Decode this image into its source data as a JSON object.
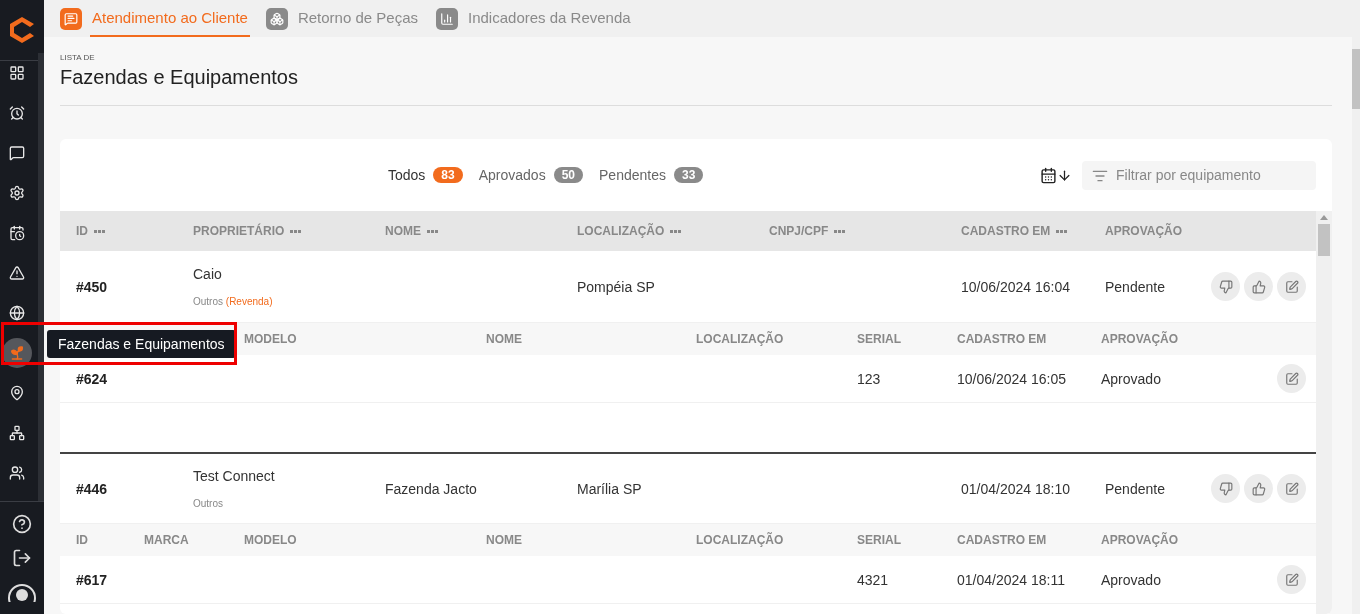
{
  "sidebar": {
    "items": [
      {
        "kind": "grid",
        "selected": false
      },
      {
        "kind": "alarm",
        "selected": false
      },
      {
        "kind": "chat",
        "selected": false
      },
      {
        "kind": "gear",
        "selected": false
      },
      {
        "kind": "calendar",
        "selected": false
      },
      {
        "kind": "warning",
        "selected": false
      },
      {
        "kind": "globe",
        "selected": false
      },
      {
        "kind": "plant",
        "selected": true
      },
      {
        "kind": "pin",
        "selected": false
      },
      {
        "kind": "network",
        "selected": false
      },
      {
        "kind": "users",
        "selected": false
      }
    ],
    "bottom": [
      {
        "kind": "help"
      },
      {
        "kind": "logout"
      },
      {
        "kind": "profile"
      }
    ],
    "tooltip": "Fazendas e Equipamentos"
  },
  "tabs": [
    {
      "label": "Atendimento ao Cliente",
      "kind": "support",
      "selected": true
    },
    {
      "label": "Retorno de Peças",
      "kind": "parts",
      "selected": false
    },
    {
      "label": "Indicadores da Revenda",
      "kind": "chart",
      "selected": false
    }
  ],
  "header": {
    "overline": "LISTA DE",
    "title": "Fazendas e Equipamentos"
  },
  "filters": [
    {
      "label": "Todos",
      "count": "83",
      "selected": true
    },
    {
      "label": "Aprovados",
      "count": "50",
      "selected": false
    },
    {
      "label": "Pendentes",
      "count": "33",
      "selected": false
    }
  ],
  "search": {
    "placeholder": "Filtrar por equipamento"
  },
  "table": {
    "columns": [
      {
        "label": "ID",
        "menu": true
      },
      {
        "label": "PROPRIETÁRIO",
        "menu": true
      },
      {
        "label": "NOME",
        "menu": true
      },
      {
        "label": "LOCALIZAÇÃO",
        "menu": true
      },
      {
        "label": "CNPJ/CPF",
        "menu": true
      },
      {
        "label": "CADASTRO EM",
        "menu": true
      },
      {
        "label": "APROVAÇÃO",
        "menu": false
      }
    ],
    "rows": [
      {
        "id": "#450",
        "owner": "Caio",
        "owner_type": "Outros",
        "owner_tag": "(Revenda)",
        "name": "",
        "location": "Pompéia SP",
        "document": "",
        "created": "10/06/2024 16:04",
        "approval": "Pendente",
        "actions": [
          {
            "kind": "reject"
          },
          {
            "kind": "approve"
          },
          {
            "kind": "edit"
          }
        ],
        "equipment": {
          "columns": [
            "MODELO",
            "NOME",
            "LOCALIZAÇÃO",
            "SERIAL",
            "CADASTRO EM",
            "APROVAÇÃO"
          ],
          "rows": [
            {
              "id": "#624",
              "serial": "123",
              "created": "10/06/2024 16:05",
              "approval": "Aprovado",
              "actions": [
                {
                  "kind": "edit"
                }
              ]
            }
          ]
        }
      },
      {
        "id": "#446",
        "owner": "Test Connect",
        "owner_type": "Outros",
        "name": "Fazenda Jacto",
        "location": "Marília SP",
        "document": "",
        "created": "01/04/2024 18:10",
        "approval": "Pendente",
        "actions": [
          {
            "kind": "reject"
          },
          {
            "kind": "approve"
          },
          {
            "kind": "edit"
          }
        ],
        "equipment": {
          "columns": [
            "ID",
            "MARCA",
            "MODELO",
            "NOME",
            "LOCALIZAÇÃO",
            "SERIAL",
            "CADASTRO EM",
            "APROVAÇÃO"
          ],
          "rows": [
            {
              "id": "#617",
              "serial": "4321",
              "created": "01/04/2024 18:11",
              "approval": "Aprovado",
              "actions": [
                {
                  "kind": "edit"
                }
              ]
            }
          ]
        }
      }
    ]
  }
}
